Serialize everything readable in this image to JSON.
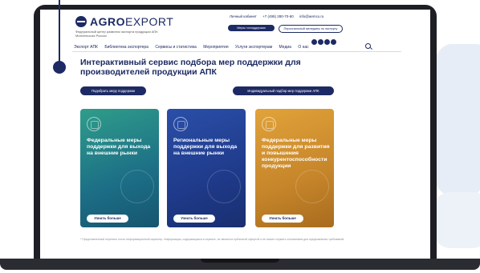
{
  "header": {
    "logo_bold": "AGRO",
    "logo_light": "EXPORT",
    "logo_sub": "Федеральный центр развития экспорта продукции АПК Минсельхоза России",
    "cabinet": "Личный кабинет",
    "phone": "+7 (495) 280-70-60",
    "email": "info@aemcx.ru",
    "btn_support": "Меры господдержки",
    "btn_consult": "Персональный менеджер по экспорту"
  },
  "nav": {
    "items": [
      "Экспорт АПК",
      "Библиотека экспортера",
      "Сервисы и статистика",
      "Мероприятия",
      "Услуги экспортерам",
      "Медиа",
      "О нас"
    ]
  },
  "main": {
    "title": "Интерактивный сервис подбора мер поддержки для производителей продукции АПК",
    "btn_select": "Подобрать меру поддержки",
    "btn_individual": "Индивидуальный подбор мер поддержки АПК",
    "cards": [
      {
        "title": "Федеральные меры поддержки для выхода на внешние рынки",
        "button": "Узнать больше"
      },
      {
        "title": "Региональные меры поддержки для выхода на внешние рынки",
        "button": "Узнать больше"
      },
      {
        "title": "Федеральные меры поддержки для развития и повышения конкурентоспособности продукции",
        "button": "Узнать больше"
      }
    ],
    "footnote": "* Представленный перечень носит информационный характер. Информация, содержащаяся в сервисе, не является публичной офертой и не может служить основанием для предъявления требований."
  },
  "colors": {
    "brand": "#1d2a63",
    "card1": "#2f9d8a",
    "card2": "#2a4fa8",
    "card3": "#e1a33a"
  }
}
